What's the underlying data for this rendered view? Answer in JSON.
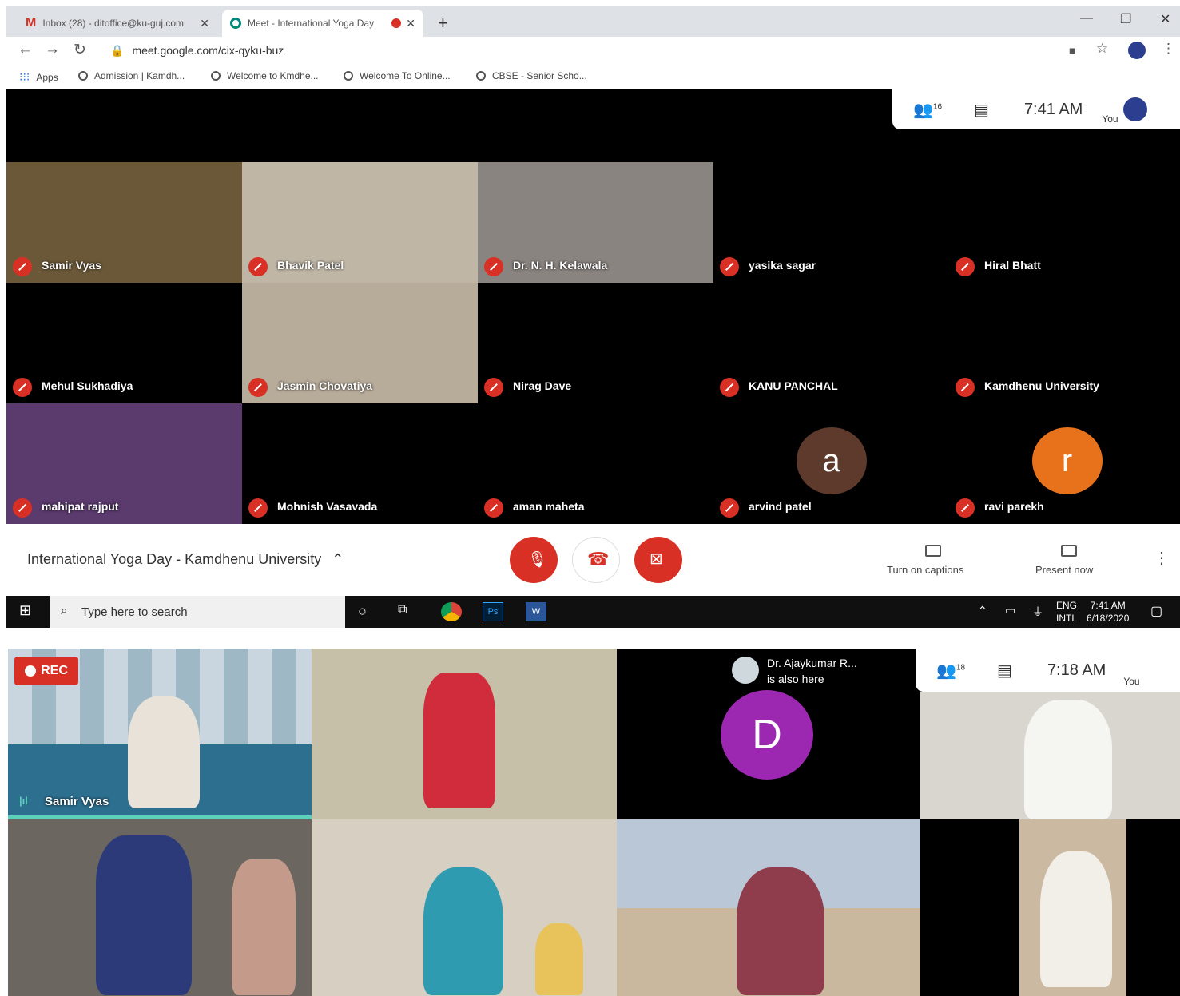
{
  "browser": {
    "tabs": [
      {
        "label": "Inbox (28) - ditoffice@ku-guj.com"
      },
      {
        "label": "Meet - International Yoga Day"
      }
    ],
    "url": "meet.google.com/cix-qyku-buz",
    "bookmarks": [
      {
        "label": "Apps"
      },
      {
        "label": "Admission | Kamdh..."
      },
      {
        "label": "Welcome to Kmdhe..."
      },
      {
        "label": "Welcome To Online..."
      },
      {
        "label": "CBSE - Senior Scho..."
      }
    ]
  },
  "meeting1": {
    "participant_count": "16",
    "time": "7:41 AM",
    "you_label": "You",
    "tiles": [
      {
        "name": "Samir Vyas",
        "bg": "#6b5838"
      },
      {
        "name": "Bhavik Patel",
        "bg": "#bfb6a6"
      },
      {
        "name": "Dr. N. H. Kelawala",
        "bg": "#8a8480"
      },
      {
        "name": "yasika sagar",
        "bg": "#000000"
      },
      {
        "name": "Hiral Bhatt",
        "bg": "#000000"
      },
      {
        "name": "Mehul Sukhadiya",
        "bg": "#000000"
      },
      {
        "name": "Jasmin Chovatiya",
        "bg": "#b7ab99"
      },
      {
        "name": "Nirag Dave",
        "bg": "#000000"
      },
      {
        "name": "KANU PANCHAL",
        "bg": "#000000"
      },
      {
        "name": "Kamdhenu University",
        "bg": "#000000"
      },
      {
        "name": "mahipat rajput",
        "bg": "#5b3a6e"
      },
      {
        "name": "Mohnish Vasavada",
        "bg": "#000000"
      },
      {
        "name": "aman maheta",
        "bg": "#000000"
      },
      {
        "name": "arvind patel",
        "bg": "#000000",
        "initial": "a",
        "avatar_color": "#5d3a2c"
      },
      {
        "name": "ravi parekh",
        "bg": "#000000",
        "initial": "r",
        "avatar_color": "#e8711c"
      }
    ],
    "title": "International Yoga Day - Kamdhenu University",
    "captions_label": "Turn on captions",
    "present_label": "Present now"
  },
  "taskbar": {
    "search_placeholder": "Type here to search",
    "lang": "ENG",
    "region": "INTL",
    "clock_time": "7:41 AM",
    "clock_date": "6/18/2020"
  },
  "meeting2": {
    "rec_label": "REC",
    "speaker_name": "Samir Vyas",
    "also_here_name": "Dr. Ajaykumar R...",
    "also_here_text": "is also here",
    "avatar_initial": "D",
    "avatar_color": "#9c27b0",
    "participant_count": "18",
    "time": "7:18 AM",
    "you_label": "You"
  }
}
